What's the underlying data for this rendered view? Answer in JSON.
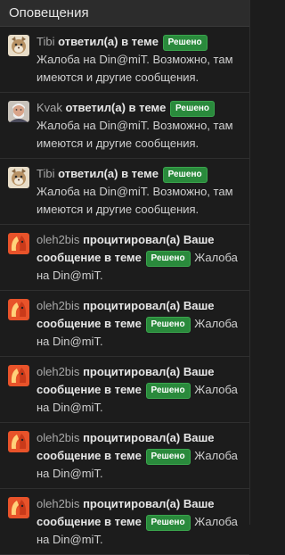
{
  "header": {
    "title": "Оповещения"
  },
  "status_color": "#2a8a3c",
  "notifications": [
    {
      "avatar": "cat-avatar-icon",
      "user": "Tibi",
      "action": "ответил(а) в теме",
      "badge": "Решено",
      "thread": "Жалоба на Din@miT. Возможно, там имеются и другие сообщения."
    },
    {
      "avatar": "person-avatar-icon",
      "user": "Kvak",
      "action": "ответил(а) в теме",
      "badge": "Решено",
      "thread": "Жалоба на Din@miT. Возможно, там имеются и другие сообщения."
    },
    {
      "avatar": "cat-avatar-icon",
      "user": "Tibi",
      "action": "ответил(а) в теме",
      "badge": "Решено",
      "thread": "Жалоба на Din@miT. Возможно, там имеются и другие сообщения."
    },
    {
      "avatar": "fox-avatar-icon",
      "user": "oleh2bis",
      "action": "процитировал(а) Ваше сообщение в теме",
      "badge": "Решено",
      "thread": "Жалоба на Din@miT."
    },
    {
      "avatar": "fox-avatar-icon",
      "user": "oleh2bis",
      "action": "процитировал(а) Ваше сообщение в теме",
      "badge": "Решено",
      "thread": "Жалоба на Din@miT."
    },
    {
      "avatar": "fox-avatar-icon",
      "user": "oleh2bis",
      "action": "процитировал(а) Ваше сообщение в теме",
      "badge": "Решено",
      "thread": "Жалоба на Din@miT."
    },
    {
      "avatar": "fox-avatar-icon",
      "user": "oleh2bis",
      "action": "процитировал(а) Ваше сообщение в теме",
      "badge": "Решено",
      "thread": "Жалоба на Din@miT."
    },
    {
      "avatar": "fox-avatar-icon",
      "user": "oleh2bis",
      "action": "процитировал(а) Ваше сообщение в теме",
      "badge": "Решено",
      "thread": "Жалоба на Din@miT."
    }
  ]
}
